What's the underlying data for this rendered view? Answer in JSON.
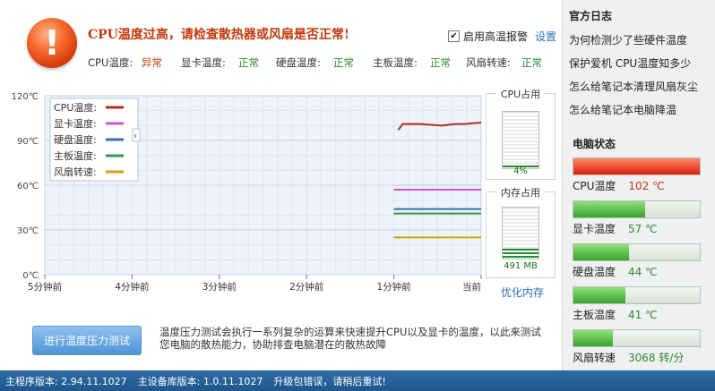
{
  "alert": {
    "title": "CPU温度过高，请检查散热器或风扇是否正常!",
    "icon": "exclamation-icon",
    "icon_glyph": "!"
  },
  "alarm_toggle": {
    "label": "启用高温报警",
    "checked": true,
    "check_glyph": "✔"
  },
  "settings_link": "设置",
  "status_row": [
    {
      "label": "CPU温度:",
      "value": "异常",
      "status": "bad"
    },
    {
      "label": "显卡温度:",
      "value": "正常",
      "status": "ok"
    },
    {
      "label": "硬盘温度:",
      "value": "正常",
      "status": "ok"
    },
    {
      "label": "主板温度:",
      "value": "正常",
      "status": "ok"
    },
    {
      "label": "风扇转速:",
      "value": "正常",
      "status": "ok"
    }
  ],
  "chart_data": {
    "type": "line",
    "ylim": [
      0,
      120
    ],
    "y_ticks": [
      "120℃",
      "90℃",
      "60℃",
      "30℃",
      "0℃"
    ],
    "x_ticks": [
      "5分钟前",
      "4分钟前",
      "3分钟前",
      "2分钟前",
      "1分钟前",
      "当前"
    ],
    "x_range_minutes_ago": [
      5,
      0
    ],
    "legend_position": "top-left",
    "grid": true,
    "series": [
      {
        "name": "CPU温度:",
        "color": "#b52b20",
        "x": [
          0.95,
          0.9,
          0.7,
          0.45,
          0.3,
          0.2,
          0.0
        ],
        "y": [
          97,
          101,
          101,
          100,
          101,
          101,
          102
        ]
      },
      {
        "name": "显卡温度:",
        "color": "#cc55cc",
        "x": [
          1.0,
          0.0
        ],
        "y": [
          57,
          57
        ]
      },
      {
        "name": "硬盘温度:",
        "color": "#3a6fb8",
        "x": [
          1.0,
          0.0
        ],
        "y": [
          44,
          44
        ]
      },
      {
        "name": "主板温度:",
        "color": "#2f9a48",
        "x": [
          1.0,
          0.0
        ],
        "y": [
          41,
          41
        ]
      },
      {
        "name": "风扇转速:",
        "color": "#d4a017",
        "x": [
          1.0,
          0.0
        ],
        "y": [
          25,
          25
        ]
      }
    ]
  },
  "cpu_gauge": {
    "title": "CPU占用",
    "value_text": "4%",
    "value": 0.04
  },
  "mem_gauge": {
    "title": "内存占用",
    "value_text": "491 MB",
    "value": 0.2
  },
  "optimize_link": "优化内存",
  "stress_test": {
    "button": "进行温度压力测试",
    "desc": "温度压力测试会执行一系列复杂的运算来快速提升CPU以及显卡的温度，以此来测试您电脑的散热能力，协助排查电脑潜在的散热故障"
  },
  "sidebar": {
    "title": "官方日志",
    "links": [
      "为何检测少了些硬件温度",
      "保护爱机 CPU温度知多少",
      "怎么给笔记本清理风扇灰尘",
      "怎么给笔记本电脑降温"
    ],
    "pc_status_title": "电脑状态",
    "bars": [
      {
        "label": "CPU温度",
        "value_text": "102 ℃",
        "level": 1.0,
        "tone": "r",
        "value_color": "#c0390b"
      },
      {
        "label": "显卡温度",
        "value_text": "57 ℃",
        "level": 0.57,
        "tone": "g",
        "value_color": "#2f8a2f"
      },
      {
        "label": "硬盘温度",
        "value_text": "44 ℃",
        "level": 0.44,
        "tone": "g",
        "value_color": "#2f8a2f"
      },
      {
        "label": "主板温度",
        "value_text": "41 ℃",
        "level": 0.41,
        "tone": "g",
        "value_color": "#2f8a2f"
      },
      {
        "label": "风扇转速",
        "value_text": "3068 转/分",
        "level": 0.31,
        "tone": "g",
        "value_color": "#2f8a2f"
      }
    ]
  },
  "statusbar": {
    "main_version": "主程序版本: 2.94.11.1027",
    "db_version": "主设备库版本: 1.0.11.1027",
    "upgrade_msg": "升级包错误，请稍后重试!"
  }
}
